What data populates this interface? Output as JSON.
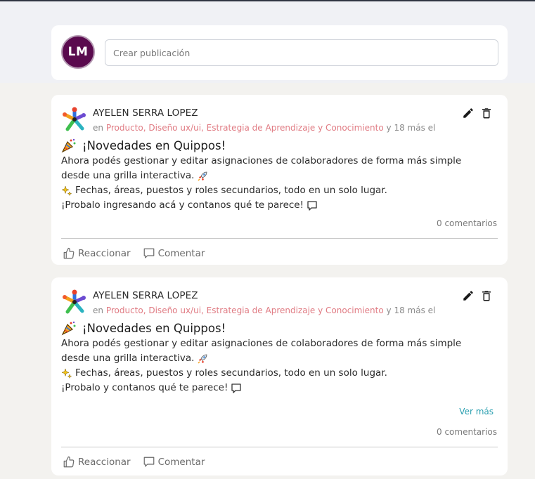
{
  "composer": {
    "avatar_initials": "LM",
    "placeholder": "Crear publicación"
  },
  "posts": [
    {
      "author": "AYELEN SERRA LOPEZ",
      "meta_prefix": "en",
      "categories": "Producto, Diseño ux/ui, Estrategia de Aprendizaje y Conocimiento",
      "meta_suffix": "y 18 más el",
      "title": "¡Novedades en Quippos!",
      "line1": "Ahora podés gestionar y editar asignaciones de colaboradores de forma más simple",
      "line2": "desde una grilla interactiva.",
      "line3": "Fechas, áreas, puestos y roles secundarios, todo en un solo lugar.",
      "line4": "¡Probalo ingresando acá y contanos qué te parece!",
      "comments": "0 comentarios",
      "react_label": "Reaccionar",
      "comment_label": "Comentar"
    },
    {
      "author": "AYELEN SERRA LOPEZ",
      "meta_prefix": "en",
      "categories": "Producto, Diseño ux/ui, Estrategia de Aprendizaje y Conocimiento",
      "meta_suffix": "y 18 más el",
      "title": "¡Novedades en Quippos!",
      "line1": "Ahora podés gestionar y editar asignaciones de colaboradores de forma más simple",
      "line2": "desde una grilla interactiva.",
      "line3": "Fechas, áreas, puestos y roles secundarios, todo en un solo lugar.",
      "line4": "¡Probalo y contanos qué te parece!",
      "see_more": "Ver más",
      "comments": "0 comentarios",
      "react_label": "Reaccionar",
      "comment_label": "Comentar"
    }
  ],
  "icons": {
    "post_logo": "colorful-asterisk-logo",
    "edit": "pencil-icon",
    "delete": "trash-icon",
    "title_emoji": "party-popper-icon",
    "rocket": "rocket-icon",
    "sparkles": "sparkles-icon",
    "speech": "speech-bubble-icon",
    "react": "thumbs-up-icon",
    "comment": "comment-icon"
  },
  "colors": {
    "category_text": "#e07b83",
    "see_more_link": "#2a9fb0",
    "avatar_bg": "#5a0a4e"
  }
}
